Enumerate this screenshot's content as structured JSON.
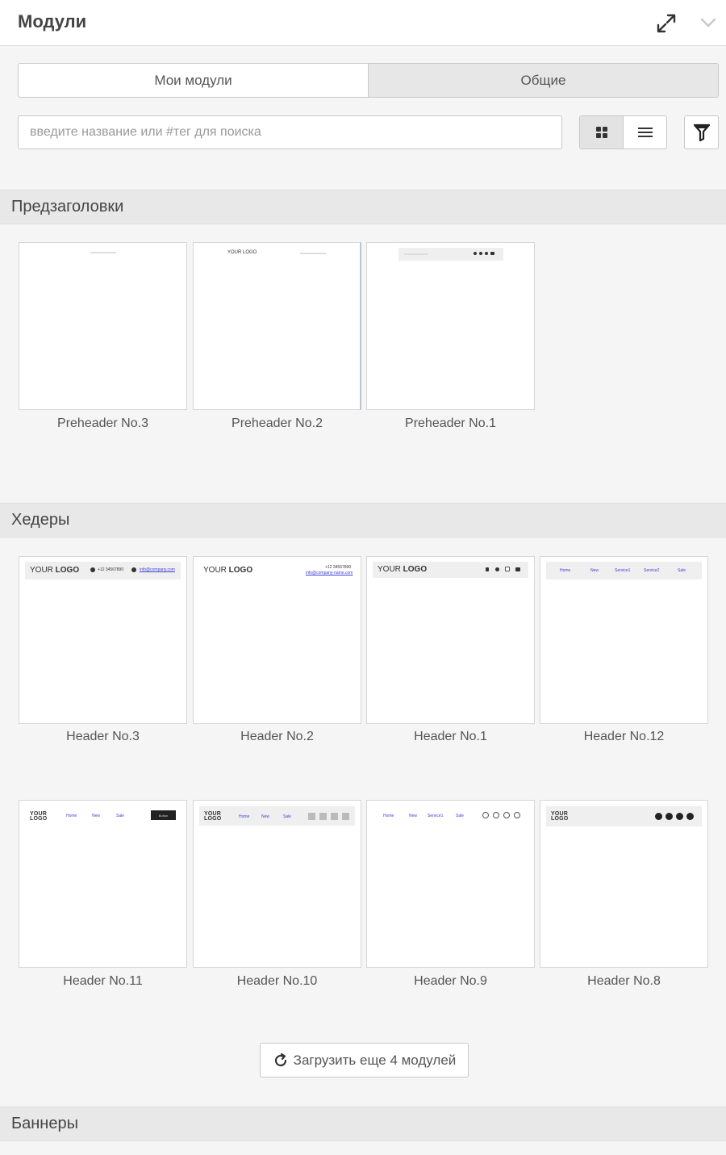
{
  "panel": {
    "title": "Модули"
  },
  "tabs": [
    {
      "label": "Мои модули",
      "active": false
    },
    {
      "label": "Общие",
      "active": true
    }
  ],
  "search": {
    "placeholder": "введите название или #тег для поиска",
    "value": ""
  },
  "view_mode": "grid",
  "sections": [
    {
      "title": "Предзаголовки",
      "modules": [
        {
          "name": "Preheader No.3"
        },
        {
          "name": "Preheader No.2",
          "preview_logo": "YOUR LOGO"
        },
        {
          "name": "Preheader No.1"
        }
      ]
    },
    {
      "title": "Хедеры",
      "modules": [
        {
          "name": "Header No.3",
          "preview_logo_a": "YOUR ",
          "preview_logo_b": "LOGO",
          "preview_phone": "+12 34567890",
          "preview_email": "info@company.com"
        },
        {
          "name": "Header No.2",
          "preview_logo_a": "YOUR ",
          "preview_logo_b": "LOGO",
          "preview_phone": "+12 34567890",
          "preview_email": "info@company-name.com"
        },
        {
          "name": "Header No.1",
          "preview_logo_a": "YOUR ",
          "preview_logo_b": "LOGO"
        },
        {
          "name": "Header No.12",
          "preview_menu": [
            "Home",
            "New",
            "Service1",
            "Service2",
            "Sale"
          ]
        },
        {
          "name": "Header No.11",
          "preview_logo_top": "YOUR",
          "preview_logo_bottom": "LOGO",
          "preview_menu": [
            "Home",
            "New",
            "Sale"
          ],
          "preview_button": "Button"
        },
        {
          "name": "Header No.10",
          "preview_logo_top": "YOUR",
          "preview_logo_bottom": "LOGO",
          "preview_menu": [
            "Home",
            "New",
            "Sale"
          ]
        },
        {
          "name": "Header No.9",
          "preview_menu": [
            "Home",
            "New",
            "Service1",
            "Sale"
          ]
        },
        {
          "name": "Header No.8",
          "preview_logo_top": "YOUR",
          "preview_logo_bottom": "LOGO"
        }
      ]
    },
    {
      "title": "Баннеры",
      "modules": []
    }
  ],
  "load_more": {
    "label": "Загрузить еще 4 модулей"
  },
  "colors": {
    "preview_link": "#3f3fd8",
    "active_tab": "#e7e7e7",
    "section_header": "#e8e8e8"
  }
}
